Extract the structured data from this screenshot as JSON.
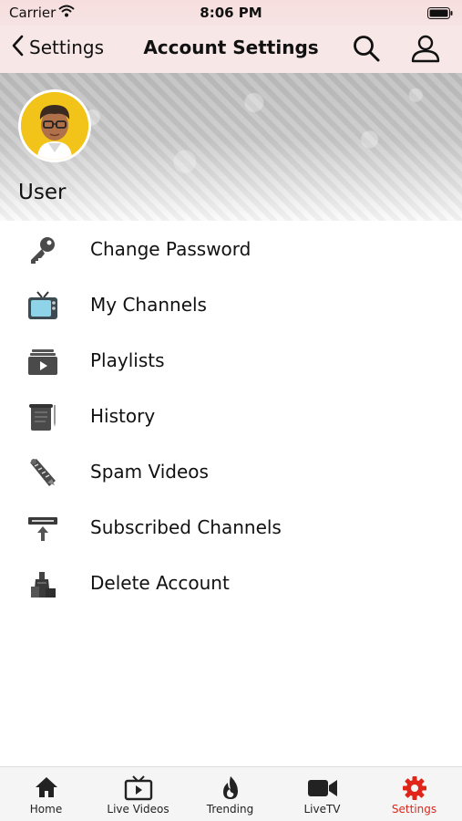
{
  "status_bar": {
    "carrier": "Carrier",
    "time": "8:06 PM"
  },
  "nav": {
    "back_label": "Settings",
    "title": "Account Settings"
  },
  "profile": {
    "name": "User"
  },
  "menu": [
    {
      "label": "Change Password",
      "icon": "key-icon"
    },
    {
      "label": "My Channels",
      "icon": "tv-icon"
    },
    {
      "label": "Playlists",
      "icon": "playlist-icon"
    },
    {
      "label": "History",
      "icon": "history-scroll-icon"
    },
    {
      "label": "Spam Videos",
      "icon": "spam-video-icon"
    },
    {
      "label": "Subscribed Channels",
      "icon": "subscribe-icon"
    },
    {
      "label": "Delete Account",
      "icon": "delete-account-icon"
    }
  ],
  "tabs": [
    {
      "label": "Home",
      "icon": "home-icon"
    },
    {
      "label": "Live Videos",
      "icon": "live-tv-icon"
    },
    {
      "label": "Trending",
      "icon": "flame-icon"
    },
    {
      "label": "LiveTV",
      "icon": "video-camera-icon"
    },
    {
      "label": "Settings",
      "icon": "gear-icon",
      "active": true
    }
  ],
  "colors": {
    "accent": "#e0261b",
    "nav_bg": "#f7e7e7",
    "icon_gray": "#444444"
  }
}
